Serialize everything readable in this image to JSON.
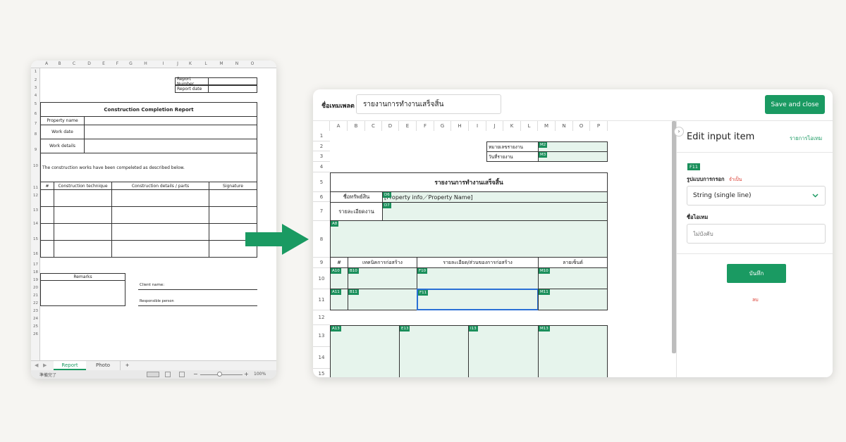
{
  "excel": {
    "columns": [
      "A",
      "B",
      "C",
      "D",
      "E",
      "F",
      "G",
      "H",
      "I",
      "J",
      "K",
      "L",
      "M",
      "N",
      "O"
    ],
    "rows": [
      "1",
      "2",
      "3",
      "4",
      "5",
      "6",
      "7",
      "8",
      "9",
      "10",
      "11",
      "12",
      "13",
      "14",
      "15",
      "16",
      "17",
      "18",
      "19",
      "20",
      "21",
      "22",
      "23",
      "24",
      "25",
      "26"
    ],
    "report_number": "Report Number",
    "report_date": "Report date",
    "title": "Construction Completion Report",
    "property_name": "Property name",
    "work_date": "Work date",
    "work_details": "Work details",
    "statement": "The construction works have been compeleted as described below.",
    "table_headers": [
      "#",
      "Construction technique",
      "Construction details / parts",
      "Signature"
    ],
    "remarks": "Remarks",
    "client_name": "Client name:",
    "responsible_person": "Responsible person",
    "tabs": [
      "Report",
      "Photo"
    ],
    "add_tab": "+",
    "status_text": "準備完了",
    "zoom_minus": "−",
    "zoom_plus": "+",
    "zoom": "100%"
  },
  "app": {
    "template_name_label": "ชื่อเทมเพลต",
    "template_name_value": "รายงานการทำงานเสร็จสิ้น",
    "save_button": "Save and close",
    "grid_columns": [
      "A",
      "B",
      "C",
      "D",
      "E",
      "F",
      "G",
      "H",
      "I",
      "J",
      "K",
      "L",
      "M",
      "N",
      "O",
      "P"
    ],
    "grid_rows": [
      "1",
      "2",
      "3",
      "4",
      "5",
      "6",
      "7",
      "8",
      "9",
      "10",
      "11",
      "12",
      "13",
      "14",
      "15"
    ],
    "report_number": "หมายเลขรายงาน",
    "report_date": "วันที่รายงาน",
    "title": "รายงานการทำงานเสร็จสิ้น",
    "property_name": "ชื่อทรัพย์สิน",
    "property_placeholder": "[Property info／Property Name]",
    "work_details": "รายละเอียดงาน",
    "table_headers": [
      "#",
      "เทคนิคการก่อสร้าง",
      "รายละเอียด/ส่วนของการก่อสร้าง",
      "ลายเซ็นต์"
    ],
    "tags": {
      "m2": "M2",
      "m3": "M3",
      "d6": "D6",
      "d7": "D7",
      "a8": "A8",
      "a10": "A10",
      "b10": "B10",
      "f10": "F10",
      "m10": "M10",
      "a11": "A11",
      "b11": "B11",
      "f11": "F11",
      "m11": "M11",
      "a13": "A13",
      "e13": "E13",
      "i13": "I13",
      "m13": "M13"
    },
    "panel": {
      "title": "Edit input item",
      "list_link": "รายการไอเทม",
      "cell_tag": "F11",
      "format_label": "รูปแบบการกรอก",
      "required": "จำเป็น",
      "format_value": "String (single line)",
      "item_name_label": "ชื่อไอเทม",
      "item_name_placeholder": "ไม่บังคับ",
      "save": "บันทึก",
      "delete": "ลบ"
    }
  },
  "colors": {
    "accent": "#1a9a62",
    "cell_fill": "#e6f4ec",
    "tag": "#1a8f5b",
    "delete": "#d9362b"
  }
}
